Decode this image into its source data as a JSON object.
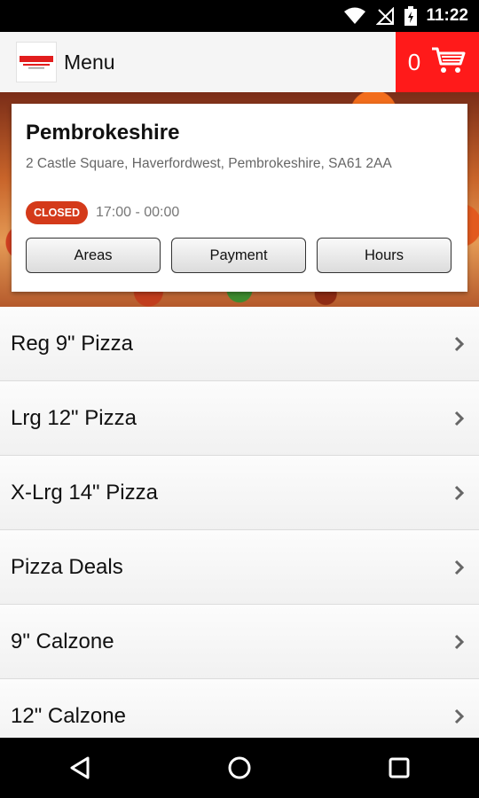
{
  "status_bar": {
    "time": "11:22",
    "icons": [
      "wifi-icon",
      "no-signal-icon",
      "battery-charging-icon"
    ]
  },
  "app_bar": {
    "title": "Menu",
    "cart_count": "0",
    "logo_icon": "store-logo",
    "cart_icon": "shopping-cart-icon",
    "cart_bg_color": "#ff1a1a"
  },
  "store": {
    "name": "Pembrokeshire",
    "address": "2 Castle Square, Haverfordwest, Pembrokeshire, SA61 2AA",
    "status": "CLOSED",
    "status_color": "#d43a1a",
    "hours": "17:00 - 00:00",
    "buttons": [
      "Areas",
      "Payment",
      "Hours"
    ]
  },
  "menu": {
    "items": [
      "Reg 9\" Pizza",
      "Lrg 12\" Pizza",
      "X-Lrg 14\" Pizza",
      "Pizza Deals",
      "9\" Calzone",
      "12\" Calzone"
    ]
  },
  "nav_bar": {
    "icons": [
      "back-icon",
      "home-icon",
      "recents-icon"
    ]
  }
}
